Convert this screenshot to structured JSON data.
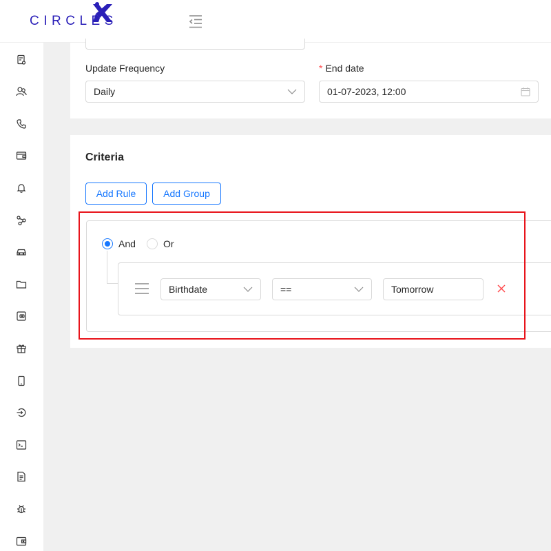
{
  "app": {
    "logo_text": "CIRCLES"
  },
  "sidebar": {
    "items": [
      {
        "icon": "document-settings-icon"
      },
      {
        "icon": "users-icon"
      },
      {
        "icon": "phone-icon"
      },
      {
        "icon": "wallet-icon"
      },
      {
        "icon": "bell-icon"
      },
      {
        "icon": "share-nodes-icon"
      },
      {
        "icon": "car-icon"
      },
      {
        "icon": "folder-icon"
      },
      {
        "icon": "purse-icon"
      },
      {
        "icon": "gift-icon"
      },
      {
        "icon": "mobile-icon"
      },
      {
        "icon": "login-icon"
      },
      {
        "icon": "terminal-icon"
      },
      {
        "icon": "file-text-icon"
      },
      {
        "icon": "bug-icon"
      },
      {
        "icon": "card-wallet-icon"
      }
    ]
  },
  "form": {
    "update_frequency": {
      "label": "Update Frequency",
      "value": "Daily"
    },
    "end_date": {
      "required_mark": "*",
      "label": "End date",
      "value": "01-07-2023, 12:00"
    }
  },
  "criteria": {
    "title": "Criteria",
    "add_rule_label": "Add Rule",
    "add_group_label": "Add Group",
    "combinator": {
      "and_label": "And",
      "or_label": "Or",
      "selected": "And"
    },
    "rule": {
      "field": "Birthdate",
      "operator": "==",
      "value": "Tomorrow",
      "remove_icon": "close-icon"
    }
  },
  "colors": {
    "brand": "#2a1fb8",
    "accent": "#1677ff",
    "danger": "#ff4d4f",
    "highlight": "#e8141b"
  }
}
